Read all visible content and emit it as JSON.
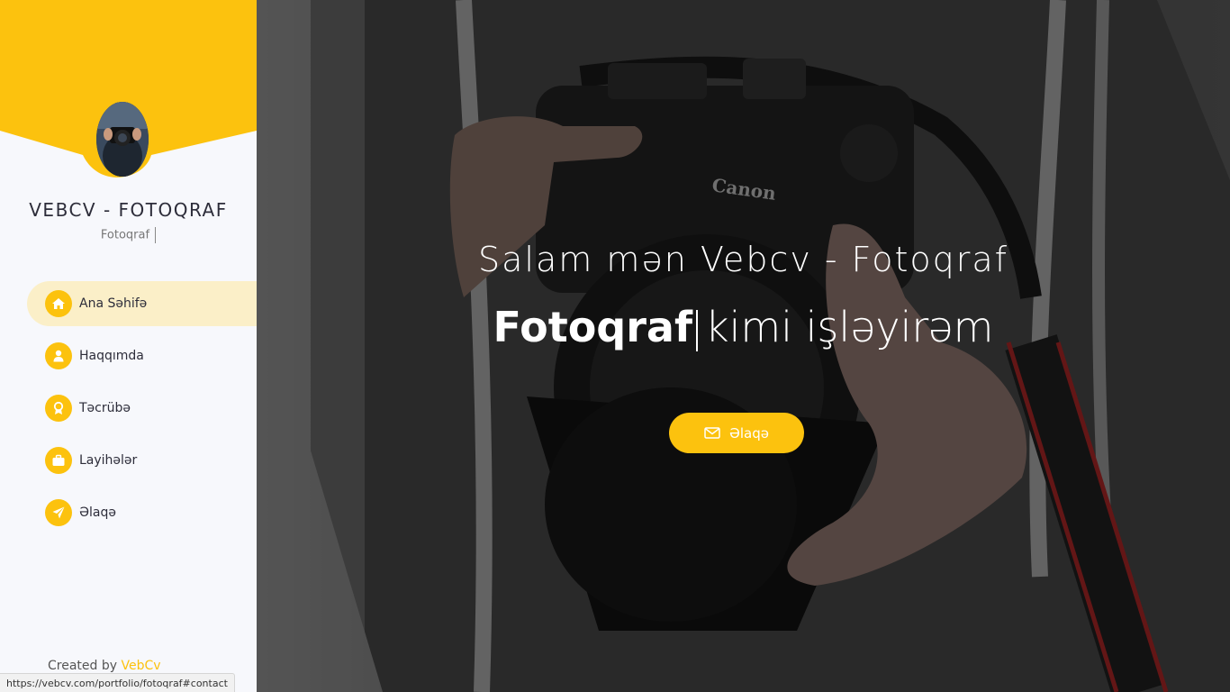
{
  "sidebar": {
    "title": "VEBCV - FOTOQRAF",
    "subtitle": "Fotoqraf",
    "nav": [
      {
        "label": "Ana Səhifə",
        "icon": "home-icon",
        "active": true
      },
      {
        "label": "Haqqımda",
        "icon": "user-icon",
        "active": false
      },
      {
        "label": "Təcrübə",
        "icon": "award-icon",
        "active": false
      },
      {
        "label": "Layihələr",
        "icon": "briefcase-icon",
        "active": false
      },
      {
        "label": "Əlaqə",
        "icon": "paper-plane-icon",
        "active": false
      }
    ],
    "credit_prefix": "Created by",
    "credit_brand": "VebCv"
  },
  "hero": {
    "greeting": "Salam mən Vebcv - Fotoqraf",
    "role": "Fotoqraf",
    "rest": "kimi işləyirəm",
    "contact_label": "Əlaqə"
  },
  "status_url": "https://vebcv.com/portfolio/fotoqraf#contact",
  "colors": {
    "accent": "#fcc20e",
    "active_nav_bg": "#fbefc8",
    "sidebar_bg": "#f7f8fc"
  }
}
